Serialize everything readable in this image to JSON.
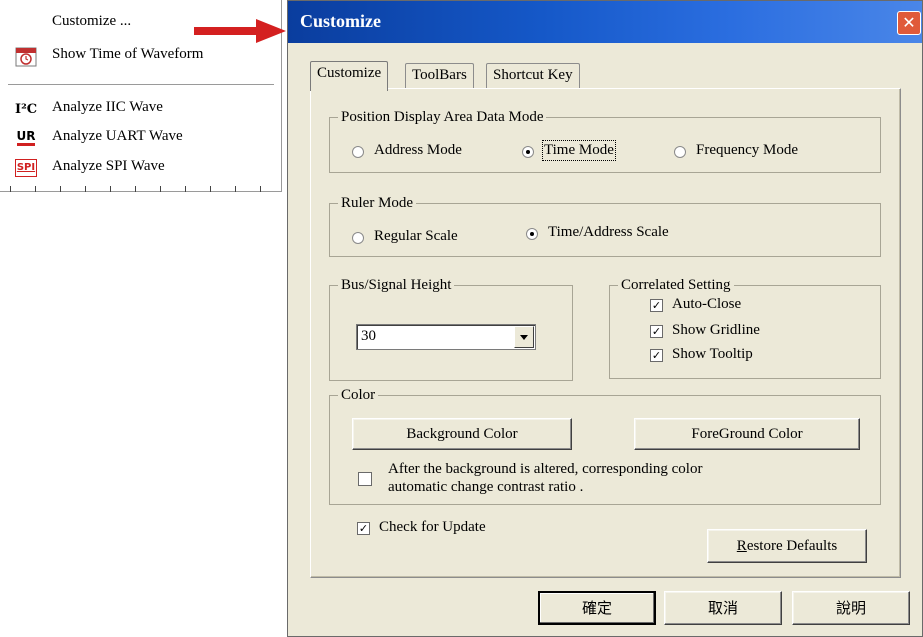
{
  "context_menu": {
    "items": [
      {
        "label": "Customize ...",
        "icon": ""
      },
      {
        "label": "Show Time of Waveform",
        "icon": "waveform-time-icon"
      },
      {
        "label": "Analyze IIC Wave",
        "icon": "iic-icon",
        "icon_text": "I²C"
      },
      {
        "label": "Analyze UART Wave",
        "icon": "uart-icon",
        "icon_text": "UR"
      },
      {
        "label": "Analyze SPI Wave",
        "icon": "spi-icon",
        "icon_text": "SPI"
      }
    ]
  },
  "arrow_color": "#d42020",
  "dialog": {
    "title": "Customize",
    "close_symbol": "✕",
    "tabs": [
      "Customize",
      "ToolBars",
      "Shortcut Key"
    ],
    "active_tab": 0,
    "position_group": {
      "label": "Position Display Area Data Mode",
      "options": [
        "Address Mode",
        "Time Mode",
        "Frequency Mode"
      ],
      "selected": 1
    },
    "ruler_group": {
      "label": "Ruler Mode",
      "options": [
        "Regular Scale",
        "Time/Address Scale"
      ],
      "selected": 1
    },
    "height_group": {
      "label": "Bus/Signal Height",
      "value": "30"
    },
    "correlated_group": {
      "label": "Correlated Setting",
      "checks": [
        {
          "label": "Auto-Close",
          "checked": true
        },
        {
          "label": "Show Gridline",
          "checked": true
        },
        {
          "label": "Show Tooltip",
          "checked": true
        }
      ]
    },
    "color_group": {
      "label": "Color",
      "background_button": "Background Color",
      "foreground_button": "ForeGround Color",
      "contrast_line1": "After the background is altered, corresponding color",
      "contrast_line2": "automatic change contrast ratio .",
      "contrast_checked": false
    },
    "check_update": {
      "label": "Check for Update",
      "checked": true
    },
    "restore_button": {
      "underlined": "R",
      "rest": "estore Defaults"
    },
    "footer": {
      "ok": "確定",
      "cancel": "取消",
      "help": "說明"
    }
  },
  "colors": {
    "dialog_bg": "#ece9d8",
    "title_bar": "#1558c8",
    "close_button": "#e05a3a"
  }
}
